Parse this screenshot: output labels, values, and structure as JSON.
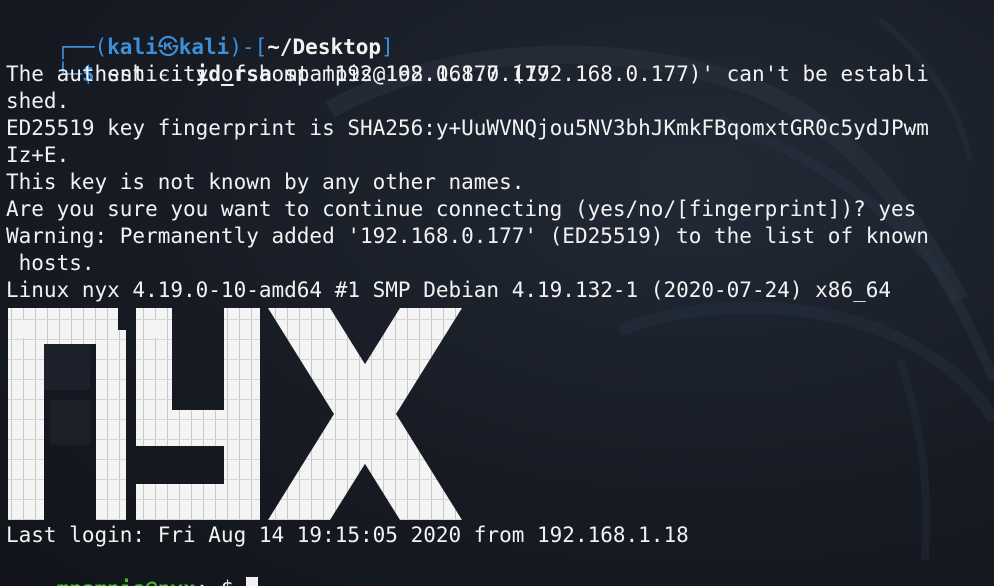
{
  "prompt": {
    "frame_open": "┌──(",
    "user": "kali",
    "at_icon": "㉿",
    "host": "kali",
    "frame_mid": ")-[",
    "cwd": "~/Desktop",
    "frame_close": "]",
    "frame_bottom": "└─",
    "dollar": "$",
    "command": "ssh",
    "flag": "-i",
    "key_file": "id_rsa",
    "target": "mpampis@192.168.0.177"
  },
  "output": [
    "The authenticity of host '192.168.0.177 (192.168.0.177)' can't be establi",
    "shed.",
    "ED25519 key fingerprint is SHA256:y+UuWVNQjou5NV3bhJKmkFBqomxtGR0c5ydJPwm",
    "Iz+E.",
    "This key is not known by any other names.",
    "Are you sure you want to continue connecting (yes/no/[fingerprint])? yes",
    "Warning: Permanently added '192.168.0.177' (ED25519) to the list of known",
    " hosts.",
    "Linux nyx 4.19.0-10-amd64 #1 SMP Debian 4.19.132-1 (2020-07-24) x86_64"
  ],
  "banner": {
    "text": "nyx",
    "color": "#f4f4f4"
  },
  "last_login": "Last login: Fri Aug 14 19:15:05 2020 from 192.168.1.18",
  "remote_prompt": {
    "user_host": "mpampis@nyx",
    "colon": ":",
    "path": "~",
    "sign": "$"
  },
  "colors": {
    "kali_blue": "#3f8fd8",
    "remote_green": "#46c02b",
    "remote_path_blue": "#4aa3ff",
    "text": "#f2f2f2",
    "background": "#171b24"
  }
}
